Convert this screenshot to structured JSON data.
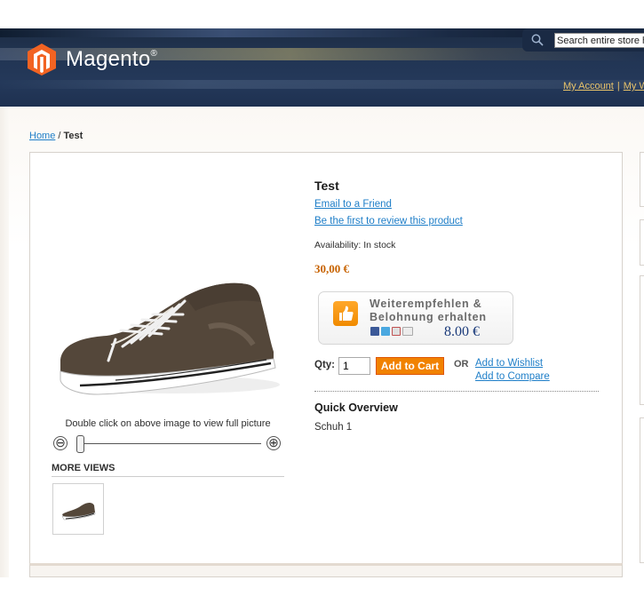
{
  "header": {
    "logo_text": "Magento",
    "logo_reg": "®",
    "search_placeholder": "Search entire store here...",
    "links": [
      "My Account",
      "My Wishlist"
    ],
    "brand_color": "#f26322"
  },
  "breadcrumb": {
    "home": "Home",
    "separator": "/",
    "current": "Test"
  },
  "product": {
    "name": "Test",
    "email_link": "Email to a Friend",
    "review_link": "Be the first to review this product",
    "availability": "Availability: In stock",
    "price": "30,00 €",
    "price_color": "#c76200",
    "zoom_hint": "Double click on above image to view full picture",
    "zoom_minus": "⊖",
    "zoom_plus": "⊕",
    "more_views": "MORE VIEWS"
  },
  "recommend": {
    "line1": "Weiterempfehlen &",
    "line2": "Belohnung erhalten",
    "amount": "8.00 €"
  },
  "cart": {
    "qty_label": "Qty:",
    "qty_value": "1",
    "add_to_cart": "Add to Cart",
    "or": "OR",
    "wishlist": "Add to Wishlist",
    "compare": "Add to Compare",
    "button_color": "#f18200"
  },
  "overview": {
    "title": "Quick Overview",
    "text": "Schuh 1"
  }
}
